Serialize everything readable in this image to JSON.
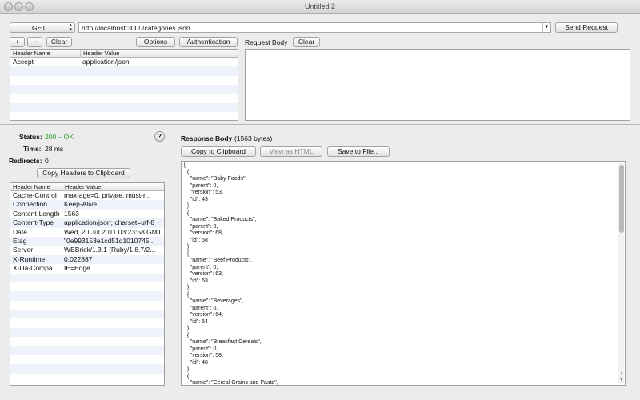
{
  "window": {
    "title": "Untitled 2"
  },
  "request": {
    "method": "GET",
    "url": "http://localhost:3000/categories.json",
    "send_label": "Send Request",
    "add_label": "+",
    "remove_label": "−",
    "clear_label": "Clear",
    "options_label": "Options",
    "auth_label": "Authentication",
    "body_label": "Request Body",
    "body_clear_label": "Clear",
    "headers_columns": [
      "Header Name",
      "Header Value"
    ],
    "headers": [
      {
        "name": "Accept",
        "value": "application/json"
      }
    ]
  },
  "response": {
    "status_label": "Status:",
    "status_value": "200 – OK",
    "status_color": "#2a9a2a",
    "time_label": "Time:",
    "time_value": "28 ms",
    "redirects_label": "Redirects:",
    "redirects_value": "0",
    "help_label": "?",
    "copy_headers_label": "Copy Headers to Clipboard",
    "headers_columns": [
      "Header Name",
      "Header Value"
    ],
    "headers": [
      {
        "name": "Cache-Control",
        "value": "max-age=0, private, must-r..."
      },
      {
        "name": "Connection",
        "value": "Keep-Alive"
      },
      {
        "name": "Content-Length",
        "value": "1563"
      },
      {
        "name": "Content-Type",
        "value": "application/json; charset=utf-8"
      },
      {
        "name": "Date",
        "value": "Wed, 20 Jul 2011 03:23:58 GMT"
      },
      {
        "name": "Etag",
        "value": "\"0e993153e1cd51d1010745..."
      },
      {
        "name": "Server",
        "value": "WEBrick/1.3.1 (Ruby/1.8.7/2..."
      },
      {
        "name": "X-Runtime",
        "value": "0.022887"
      },
      {
        "name": "X-Ua-Compa...",
        "value": "IE=Edge"
      }
    ],
    "body_label": "Response Body",
    "body_size": "(1563 bytes)",
    "copy_clipboard_label": "Copy to Clipboard",
    "view_html_label": "View as HTML",
    "save_file_label": "Save to File...",
    "body_text": "[\n  {\n    \"name\": \"Baby Foods\",\n    \"parent\": 0,\n    \"version\": 53,\n    \"id\": 43\n  },\n  {\n    \"name\": \"Baked Products\",\n    \"parent\": 0,\n    \"version\": 68,\n    \"id\": 58\n  },\n  {\n    \"name\": \"Beef Products\",\n    \"parent\": 0,\n    \"version\": 63,\n    \"id\": 53\n  },\n  {\n    \"name\": \"Beverages\",\n    \"parent\": 0,\n    \"version\": 64,\n    \"id\": 54\n  },\n  {\n    \"name\": \"Breakfast Cereals\",\n    \"parent\": 0,\n    \"version\": 58,\n    \"id\": 48\n  },\n  {\n    \"name\": \"Cereal Grains and Pasta\","
  }
}
